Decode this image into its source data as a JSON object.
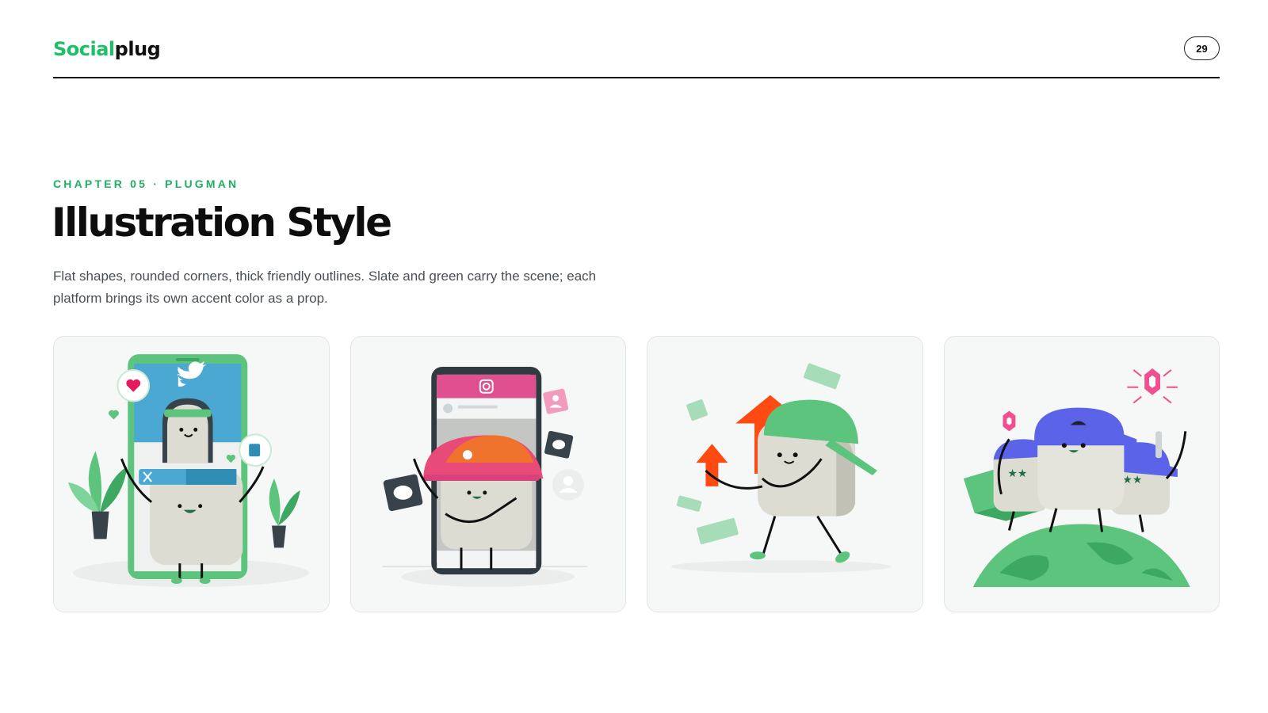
{
  "header": {
    "logo_part1": "Social",
    "logo_part2": "plug",
    "page_number": "29"
  },
  "section": {
    "eyebrow": "CHAPTER 05 · PLUGMAN",
    "title": "Illustration Style",
    "description": "Flat shapes, rounded corners, thick friendly outlines. Slate and green carry the scene; each platform brings its own accent color as a prop."
  },
  "colors": {
    "brand_green": "#1fbf6a",
    "slate": "#37424a",
    "twitter_blue": "#4aa8d2",
    "instagram_pink": "#e0508f",
    "growth_orange": "#ff4a12",
    "accent_purple": "#5b63e8"
  },
  "illustrations": [
    {
      "scene": "plugman-twitter-phone",
      "icons": [
        "heart-icon",
        "twitter-bird-icon",
        "x-logo-icon",
        "share-icon"
      ]
    },
    {
      "scene": "plugman-instagram-phone",
      "icons": [
        "instagram-icon",
        "chat-bubble-icon",
        "profile-icon",
        "avatar-icon"
      ]
    },
    {
      "scene": "plugman-growth-arrows",
      "icons": [
        "up-arrow-icon",
        "money-bill-icon"
      ]
    },
    {
      "scene": "plugman-team-on-globe",
      "icons": [
        "gem-icon",
        "globe-icon",
        "laptop-icon"
      ]
    }
  ]
}
